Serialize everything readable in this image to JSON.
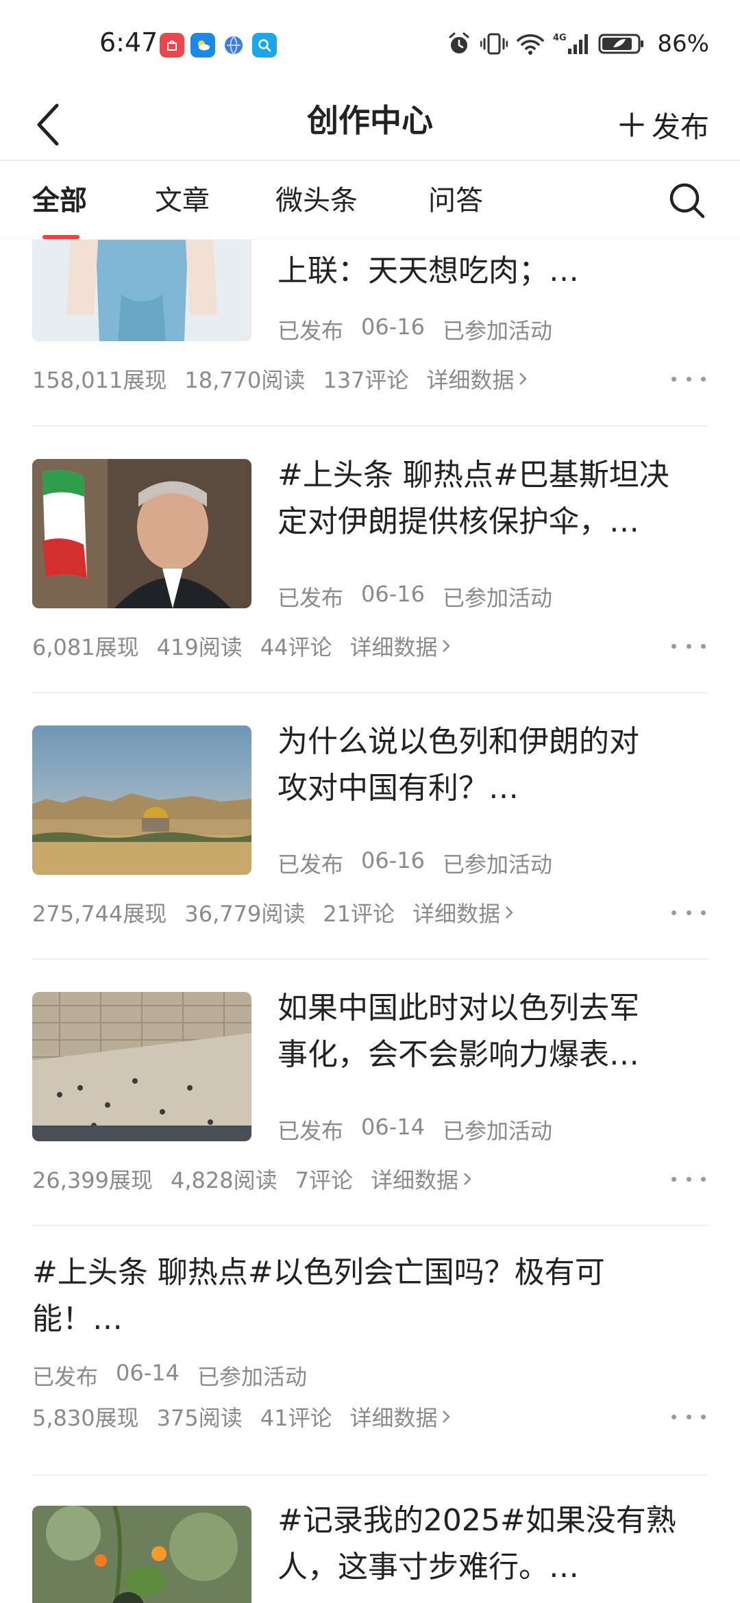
{
  "status_bar": {
    "time": "6:47",
    "battery_percent": "86%",
    "network_label": "4G",
    "app_icons": [
      "huawei-appgallery-icon",
      "weather-icon",
      "browser-icon",
      "search-app-icon"
    ]
  },
  "header": {
    "title": "创作中心",
    "publish_label": "发布"
  },
  "tabs": [
    {
      "label": "全部",
      "active": true
    },
    {
      "label": "文章",
      "active": false
    },
    {
      "label": "微头条",
      "active": false
    },
    {
      "label": "问答",
      "active": false
    }
  ],
  "items": [
    {
      "title_lines": [
        "上联：天天想吃肉；…"
      ],
      "status": "已发布",
      "date": "06-16",
      "activity": "已参加活动",
      "impressions": "158,011展现",
      "reads": "18,770阅读",
      "comments": "137评论",
      "detail_label": "详细数据"
    },
    {
      "title_lines": [
        "#上头条 聊热点#巴基斯坦决",
        "定对伊朗提供核保护伞，…"
      ],
      "status": "已发布",
      "date": "06-16",
      "activity": "已参加活动",
      "impressions": "6,081展现",
      "reads": "419阅读",
      "comments": "44评论",
      "detail_label": "详细数据"
    },
    {
      "title_lines": [
        "为什么说以色列和伊朗的对",
        "攻对中国有利？…"
      ],
      "status": "已发布",
      "date": "06-16",
      "activity": "已参加活动",
      "impressions": "275,744展现",
      "reads": "36,779阅读",
      "comments": "21评论",
      "detail_label": "详细数据"
    },
    {
      "title_lines": [
        "如果中国此时对以色列去军",
        "事化，会不会影响力爆表…"
      ],
      "status": "已发布",
      "date": "06-14",
      "activity": "已参加活动",
      "impressions": "26,399展现",
      "reads": "4,828阅读",
      "comments": "7评论",
      "detail_label": "详细数据"
    },
    {
      "title_lines": [
        "#上头条 聊热点#以色列会亡国吗？极有可",
        "能！…"
      ],
      "status": "已发布",
      "date": "06-14",
      "activity": "已参加活动",
      "impressions": "5,830展现",
      "reads": "375阅读",
      "comments": "41评论",
      "detail_label": "详细数据"
    },
    {
      "title_lines": [
        "#记录我的2025#如果没有熟",
        "人，这事寸步难行。…"
      ]
    }
  ],
  "colors": {
    "accent": "#f04142",
    "text_primary": "#222222",
    "text_secondary": "#8a8a8a",
    "divider": "#efefef"
  }
}
